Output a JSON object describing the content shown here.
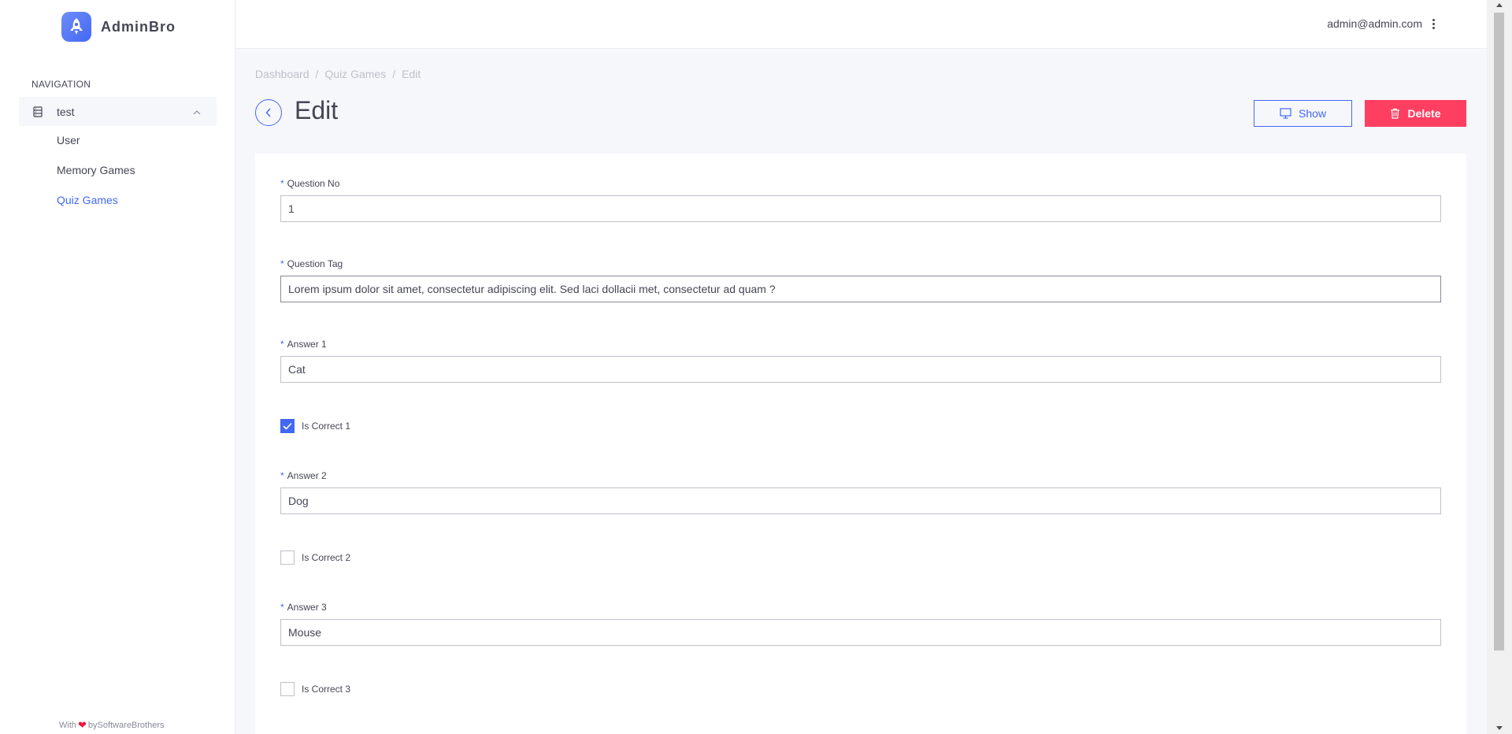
{
  "brand": {
    "name": "AdminBro",
    "icon": "rocket-icon"
  },
  "sidebar": {
    "heading": "NAVIGATION",
    "parent": {
      "label": "test",
      "icon": "database-icon",
      "expanded": true
    },
    "items": [
      {
        "label": "User",
        "active": false
      },
      {
        "label": "Memory Games",
        "active": false
      },
      {
        "label": "Quiz Games",
        "active": true
      }
    ],
    "footer": {
      "prefix": "With",
      "heart": "❤",
      "suffix": "bySoftwareBrothers"
    }
  },
  "topbar": {
    "user_email": "admin@admin.com",
    "menu_icon": "more-vertical-icon"
  },
  "breadcrumb": [
    {
      "label": "Dashboard"
    },
    {
      "separator": "/"
    },
    {
      "label": "Quiz Games"
    },
    {
      "label": "Edit"
    }
  ],
  "page": {
    "title": "Edit"
  },
  "actions": {
    "show_label": "Show",
    "delete_label": "Delete"
  },
  "form": {
    "required_mark": "*",
    "question_no": {
      "label": "Question No",
      "value": "1"
    },
    "question_tag": {
      "label": "Question Tag",
      "value": "Lorem ipsum dolor sit amet, consectetur adipiscing elit. Sed laci dollacii met, consectetur ad quam ?"
    },
    "answer1": {
      "label": "Answer 1",
      "value": "Cat"
    },
    "is_correct1": {
      "label": "Is Correct 1",
      "checked": true
    },
    "answer2": {
      "label": "Answer 2",
      "value": "Dog"
    },
    "is_correct2": {
      "label": "Is Correct 2",
      "checked": false
    },
    "answer3": {
      "label": "Answer 3",
      "value": "Mouse"
    },
    "is_correct3": {
      "label": "Is Correct 3",
      "checked": false
    }
  },
  "colors": {
    "primary": "#4268f6",
    "danger": "#fe3f62",
    "text": "#454655",
    "muted": "#c0c0ca",
    "background": "#f6f7fb"
  }
}
